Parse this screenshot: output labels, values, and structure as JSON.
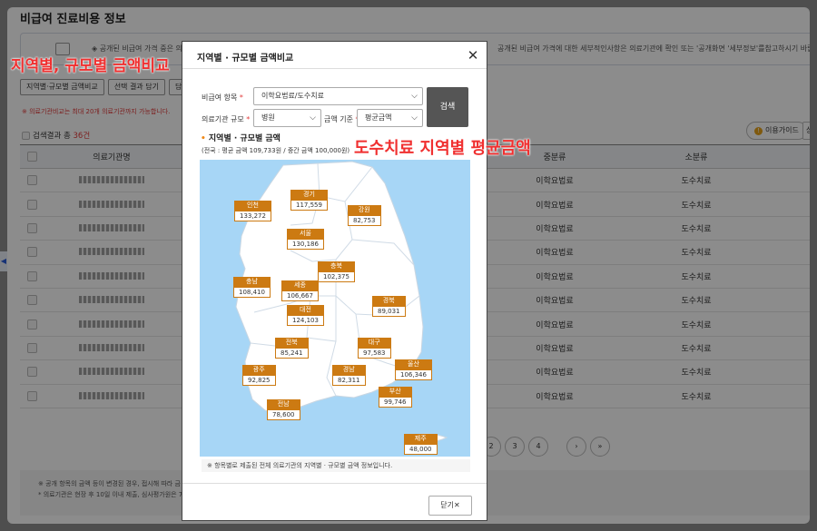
{
  "page": {
    "title": "비급여 진료비용 정보",
    "notice_text": "◈ 공개된 비급여 가격 중은 의료",
    "notice_text_right": "공개된 비급여 가격에 대한 세부적인사항은 의료기관에 확인 또는 '공개화면 '세부정보'를참고하시기 바랍",
    "buttons": [
      "지역별·규모별 금액비교",
      "선택 결과 담기",
      "담"
    ],
    "red_tip": "※ 의료기관비교는 최대 20개 의료기관까지 가능합니다.",
    "result_prefix": "검색결과 총",
    "result_count": "36건",
    "guide_label": "이용가이드",
    "guide_icon": "info-icon",
    "sort_label": "상",
    "columns": [
      "의료기관명",
      "중분류",
      "소분류"
    ],
    "rows": [
      {
        "mid": "이학요법료",
        "small": "도수치료"
      },
      {
        "mid": "이학요법료",
        "small": "도수치료"
      },
      {
        "mid": "이학요법료",
        "small": "도수치료"
      },
      {
        "mid": "이학요법료",
        "small": "도수치료"
      },
      {
        "mid": "이학요법료",
        "small": "도수치료"
      },
      {
        "mid": "이학요법료",
        "small": "도수치료"
      },
      {
        "mid": "이학요법료",
        "small": "도수치료"
      },
      {
        "mid": "이학요법료",
        "small": "도수치료"
      },
      {
        "mid": "이학요법료",
        "small": "도수치료"
      },
      {
        "mid": "이학요법료",
        "small": "도수치료"
      }
    ],
    "pages": [
      "2",
      "3",
      "4"
    ],
    "next": "›",
    "last": "»",
    "footer1": "※ 공개 항목의 금액 등이 변경된 경우, 접시해 따라 금",
    "footer2": "* 의료기관은 현장 후 10일 이내 제출, 심사평가원은 7일"
  },
  "modal": {
    "title": "지역별 · 규모별 금액비교",
    "close_icon": "close-icon",
    "item_label": "비급여 항목",
    "item_value": "이학요법료/도수치료",
    "scale_label": "의료기관 규모",
    "scale_value": "병원",
    "basis_label": "금액 기준",
    "basis_value": "평균금액",
    "required_mark": "*",
    "search_label": "검색",
    "section_title": "지역별 · 규모별 금액",
    "section_bullet": "•",
    "section_sub": "(전국 : 평균 금액 109,733원 / 중간 금액 100,000원)",
    "note": "※ 항목별로 제출된 전체 의료기관의 지역별 · 규모별 금액 정보입니다.",
    "close_label": "닫기",
    "close_x": "✕",
    "map_colors": {
      "sea": "#a7d6f6",
      "land": "#ffffff",
      "border": "#c9d6e2",
      "label_bg": "#cc7a12"
    },
    "regions": [
      {
        "name": "인천",
        "value": "133,272"
      },
      {
        "name": "경기",
        "value": "117,559"
      },
      {
        "name": "강원",
        "value": "82,753"
      },
      {
        "name": "서울",
        "value": "130,186"
      },
      {
        "name": "충북",
        "value": "102,375"
      },
      {
        "name": "충남",
        "value": "108,410"
      },
      {
        "name": "세종",
        "value": "106,667"
      },
      {
        "name": "경북",
        "value": "89,031"
      },
      {
        "name": "대전",
        "value": "124,103"
      },
      {
        "name": "전북",
        "value": "85,241"
      },
      {
        "name": "대구",
        "value": "97,583"
      },
      {
        "name": "광주",
        "value": "92,825"
      },
      {
        "name": "경남",
        "value": "82,311"
      },
      {
        "name": "울산",
        "value": "106,346"
      },
      {
        "name": "부산",
        "value": "99,746"
      },
      {
        "name": "전남",
        "value": "78,600"
      },
      {
        "name": "제주",
        "value": "48,000"
      }
    ]
  },
  "annotations": {
    "label1": "지역별, 규모별 금액비교",
    "label2": "도수치료 지역별 평균금액",
    "color": "#f03030"
  }
}
